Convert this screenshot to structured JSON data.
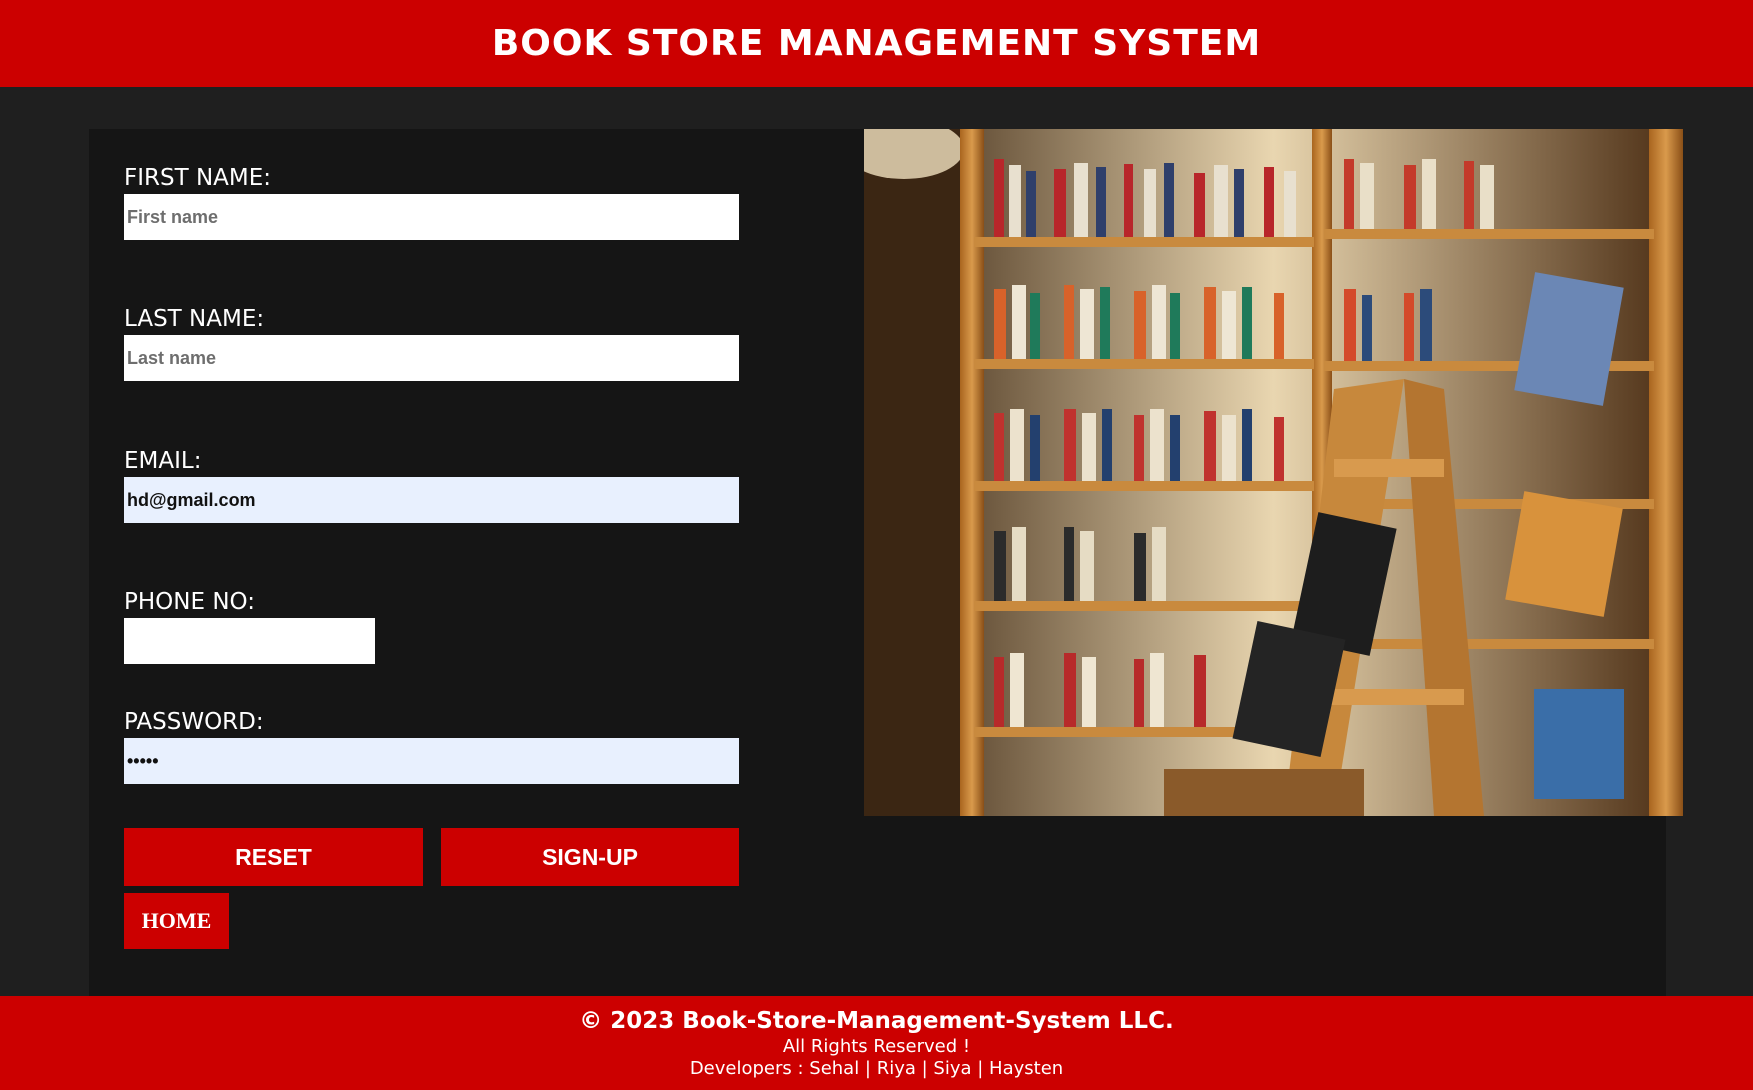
{
  "header": {
    "title": "BOOK STORE MANAGEMENT SYSTEM"
  },
  "form": {
    "first_name": {
      "label": "FIRST NAME:",
      "placeholder": "First name",
      "value": ""
    },
    "last_name": {
      "label": "LAST NAME:",
      "placeholder": "Last name",
      "value": ""
    },
    "email": {
      "label": "EMAIL:",
      "placeholder": "",
      "value": "hd@gmail.com"
    },
    "phone": {
      "label": "PHONE NO:",
      "placeholder": "",
      "value": ""
    },
    "password": {
      "label": "PASSWORD:",
      "placeholder": "",
      "value": "•••••"
    },
    "reset_label": "RESET",
    "signup_label": "SIGN-UP",
    "home_label": "HOME"
  },
  "image": {
    "subject": "bookstore-shelves-photo"
  },
  "footer": {
    "copyright": "© 2023 Book-Store-Management-System LLC.",
    "rights": "All Rights Reserved !",
    "developers": "Developers : Sehal | Riya | Siya | Haysten"
  },
  "colors": {
    "accent": "#cc0000",
    "background": "#1f1f1f",
    "panel": "#151515",
    "autofill": "#e8f0fe"
  }
}
